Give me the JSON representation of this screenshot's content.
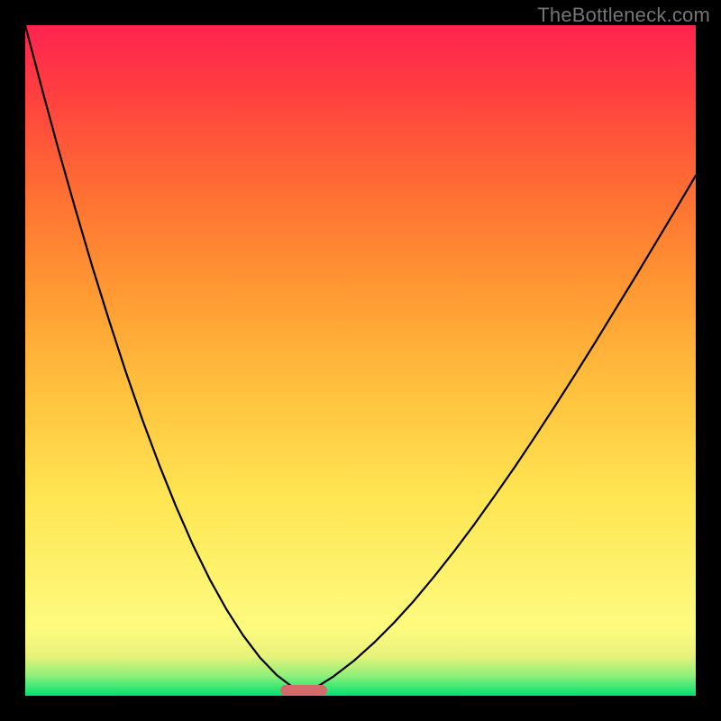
{
  "watermark": "TheBottleneck.com",
  "chart_data": {
    "type": "line",
    "title": "",
    "xlabel": "",
    "ylabel": "",
    "xlim": [
      0,
      100
    ],
    "ylim": [
      0,
      100
    ],
    "cusp_x": 41,
    "marker": {
      "x_start": 38,
      "x_end": 45,
      "y": 0
    },
    "gradient_stops": [
      {
        "pos": 0,
        "color": "#00e070"
      },
      {
        "pos": 3,
        "color": "#8ff07a"
      },
      {
        "pos": 6,
        "color": "#e9f27a"
      },
      {
        "pos": 10,
        "color": "#fdfb7f"
      },
      {
        "pos": 30,
        "color": "#ffe552"
      },
      {
        "pos": 45,
        "color": "#ffc23e"
      },
      {
        "pos": 60,
        "color": "#ff9a33"
      },
      {
        "pos": 75,
        "color": "#ff6f33"
      },
      {
        "pos": 90,
        "color": "#ff3f40"
      },
      {
        "pos": 100,
        "color": "#ff2350"
      }
    ],
    "series": [
      {
        "name": "left-branch",
        "x": [
          0.0,
          2.5,
          5.0,
          7.5,
          10.0,
          12.5,
          15.0,
          17.5,
          20.0,
          22.5,
          25.0,
          27.5,
          30.0,
          32.5,
          35.0,
          37.5,
          40.0,
          41.0
        ],
        "y": [
          100.0,
          90.5,
          81.3,
          72.5,
          64.0,
          56.0,
          48.3,
          41.1,
          34.4,
          28.2,
          22.5,
          17.4,
          12.9,
          9.0,
          5.7,
          3.1,
          1.2,
          0.0
        ]
      },
      {
        "name": "right-branch",
        "x": [
          41.0,
          43.0,
          46.0,
          49.0,
          52.0,
          55.0,
          58.0,
          61.0,
          64.0,
          67.0,
          70.0,
          73.0,
          76.0,
          79.0,
          82.0,
          85.0,
          88.0,
          91.0,
          94.0,
          97.0,
          100.0
        ],
        "y": [
          0.0,
          1.0,
          2.9,
          5.2,
          7.9,
          10.9,
          14.2,
          17.8,
          21.6,
          25.6,
          29.8,
          34.1,
          38.6,
          43.2,
          47.9,
          52.7,
          57.6,
          62.5,
          67.5,
          72.5,
          77.6
        ]
      }
    ]
  }
}
